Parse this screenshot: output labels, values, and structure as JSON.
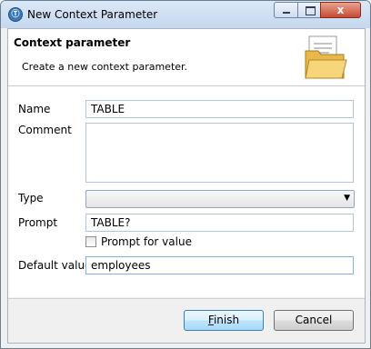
{
  "window": {
    "title": "New Context Parameter",
    "close_glyph": "x"
  },
  "banner": {
    "title": "Context parameter",
    "description": "Create a new context parameter."
  },
  "form": {
    "name_label": "Name",
    "name_value": "TABLE",
    "comment_label": "Comment",
    "comment_value": "",
    "type_label": "Type",
    "type_value": "",
    "prompt_label": "Prompt",
    "prompt_value": "TABLE?",
    "prompt_for_value_label": "Prompt for value",
    "prompt_for_value_checked": false,
    "default_value_label": "Default value",
    "default_value": "employees"
  },
  "buttons": {
    "finish_mnemonic": "F",
    "finish_rest": "inish",
    "cancel_label": "Cancel"
  },
  "icons": {
    "app": "talend-app-icon",
    "banner": "open-folder-icon"
  }
}
